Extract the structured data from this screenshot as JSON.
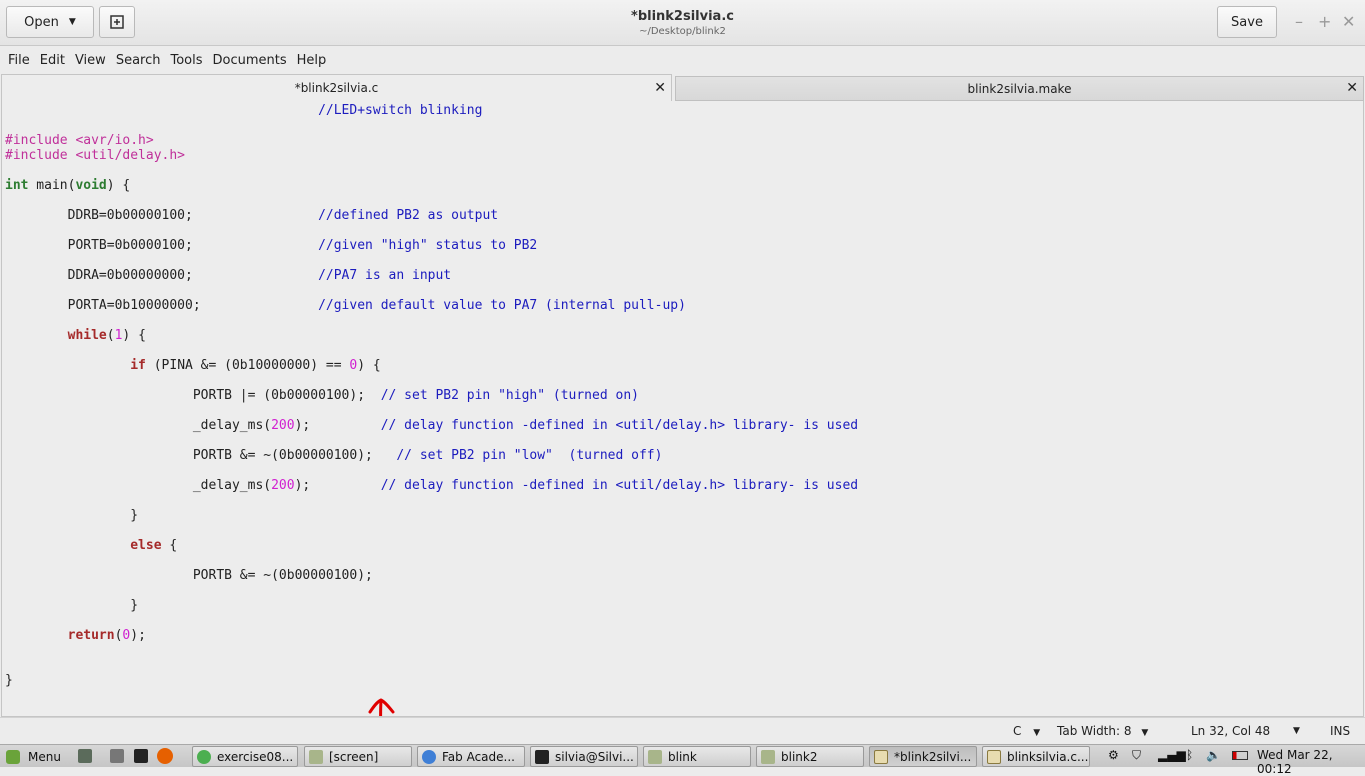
{
  "window": {
    "title": "*blink2silvia.c",
    "subtitle": "~/Desktop/blink2",
    "open_label": "Open",
    "save_label": "Save"
  },
  "menu": [
    "File",
    "Edit",
    "View",
    "Search",
    "Tools",
    "Documents",
    "Help"
  ],
  "tabs": [
    {
      "label": "*blink2silvia.c",
      "active": true
    },
    {
      "label": "blink2silvia.make",
      "active": false
    }
  ],
  "code_lines": [
    "                                        //LED+switch blinking",
    "",
    "#include <avr/io.h>",
    "#include <util/delay.h>",
    "",
    "int main(void) {",
    "",
    "        DDRB=0b00000100;                //defined PB2 as output",
    "",
    "        PORTB=0b0000100;                //given \"high\" status to PB2",
    "",
    "        DDRA=0b00000000;                //PA7 is an input",
    "",
    "        PORTA=0b10000000;               //given default value to PA7 (internal pull-up)",
    "",
    "        while(1) {",
    "",
    "                if (PINA &= (0b10000000) == 0) {",
    "",
    "                        PORTB |= (0b00000100);  // set PB2 pin \"high\" (turned on)",
    "",
    "                        _delay_ms(200);         // delay function -defined in <util/delay.h> library- is used",
    "",
    "                        PORTB &= ~(0b00000100);   // set PB2 pin \"low\"  (turned off)",
    "",
    "                        _delay_ms(200);         // delay function -defined in <util/delay.h> library- is used",
    "",
    "                }",
    "",
    "                else {",
    "",
    "                        PORTB &= ~(0b00000100);",
    "",
    "                }",
    "",
    "        return(0);",
    "",
    "",
    "}"
  ],
  "status": {
    "language": "C",
    "tab_width": "Tab Width: 8",
    "position": "Ln 32, Col 48",
    "mode": "INS"
  },
  "taskbar": {
    "menu_label": "Menu",
    "items": [
      {
        "label": "exercise08...",
        "icon": "chrome-icon"
      },
      {
        "label": "[screen]",
        "icon": "folder-icon"
      },
      {
        "label": "Fab Acade...",
        "icon": "chrome-icon"
      },
      {
        "label": "silvia@Silvi...",
        "icon": "terminal-icon"
      },
      {
        "label": "blink",
        "icon": "folder-icon"
      },
      {
        "label": "blink2",
        "icon": "folder-icon"
      },
      {
        "label": "*blink2silvi...",
        "icon": "text-editor-icon",
        "active": true
      },
      {
        "label": "blinksilvia.c...",
        "icon": "text-editor-icon"
      }
    ],
    "clock": "Wed Mar 22, 00:12"
  },
  "colors": {
    "comment": "#1c1cbe",
    "preprocessor": "#c0309a",
    "keyword": "#a52a2a",
    "type": "#2e7d32",
    "number": "#d020d0",
    "annotation_arrow": "#e00000"
  }
}
